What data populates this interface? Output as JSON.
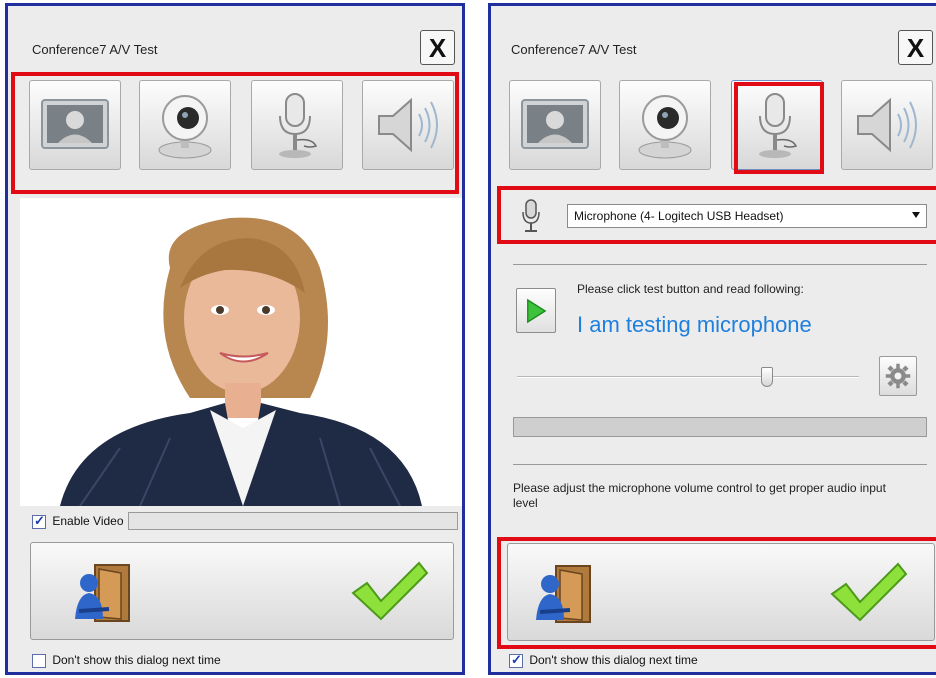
{
  "left_dialog": {
    "title": "Conference7 A/V Test",
    "close_label": "X",
    "tabs": [
      {
        "name": "video-preview",
        "icon": "person-screen-icon"
      },
      {
        "name": "webcam",
        "icon": "webcam-icon"
      },
      {
        "name": "microphone",
        "icon": "microphone-icon"
      },
      {
        "name": "speaker",
        "icon": "speaker-icon"
      }
    ],
    "enable_video_label": "Enable Video",
    "enable_video_checked": true,
    "dont_show_label": "Don't show this dialog next time",
    "dont_show_checked": false
  },
  "right_dialog": {
    "title": "Conference7 A/V Test",
    "close_label": "X",
    "selected_tab": "microphone",
    "device_select_value": "Microphone (4- Logitech USB Headset)",
    "instruction": "Please click test button and read following:",
    "test_phrase": "I am testing microphone",
    "volume_level": 0.73,
    "input_level": 0.0,
    "note": "Please adjust the microphone volume control to get proper audio input level",
    "dont_show_label": "Don't show this dialog next time",
    "dont_show_checked": true
  },
  "colors": {
    "highlight": "#e10b16",
    "window_border": "#1f2f9e",
    "phrase_text": "#1e7fde",
    "confirm_check": "#6fcd2b"
  },
  "icons": {
    "exit": "exit-door-icon",
    "confirm": "green-checkmark-icon",
    "play": "play-icon",
    "settings": "gear-icon"
  }
}
